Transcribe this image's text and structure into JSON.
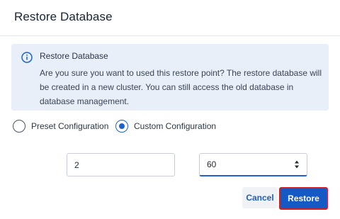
{
  "dialog": {
    "title": "Restore Database"
  },
  "alert": {
    "icon": "info-circle-icon",
    "title": "Restore Database",
    "message": "Are you sure you want to used this restore point? The restore database will be created in a new cluster. You can still access the old database in database management."
  },
  "config_options": [
    {
      "label": "Preset Configuration",
      "selected": false
    },
    {
      "label": "Custom Configuration",
      "selected": true
    }
  ],
  "inputs": {
    "first_value": "2",
    "second_value": "60"
  },
  "buttons": {
    "cancel_label": "Cancel",
    "restore_label": "Restore"
  },
  "colors": {
    "accent": "#1d63c9",
    "alert_bg": "#e8eff8",
    "restore_bg": "#1559c5",
    "highlight_border": "#d42020"
  }
}
